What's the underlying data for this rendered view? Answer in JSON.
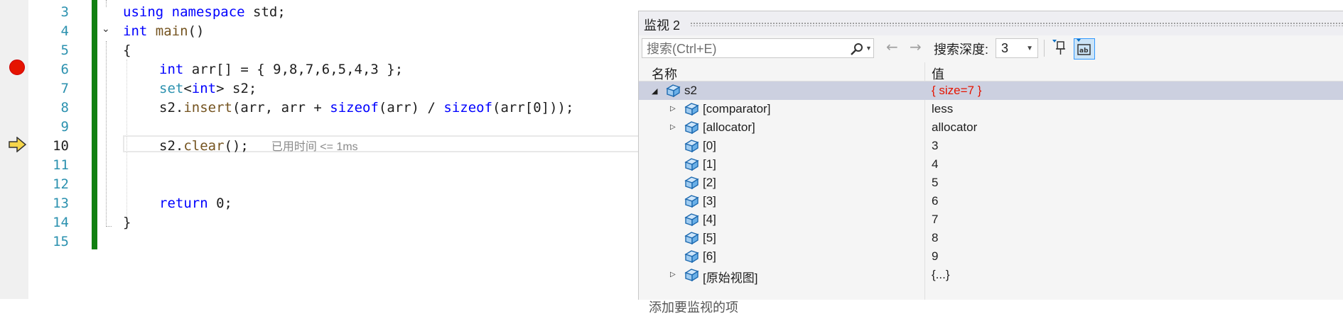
{
  "editor": {
    "line_numbers": [
      "3",
      "4",
      "5",
      "6",
      "7",
      "8",
      "9",
      "10",
      "11",
      "12",
      "13",
      "14",
      "15"
    ],
    "current_line": "10",
    "code": {
      "l3": {
        "kw1": "using",
        "kw2": "namespace",
        "rest": " std;"
      },
      "l4": {
        "kw": "int",
        "fn": "main",
        "rest": "()"
      },
      "l5": "{",
      "l6": {
        "kw": "int",
        "rest": " arr[] = { 9,8,7,6,5,4,3 };"
      },
      "l7": {
        "ty1": "set",
        "lt": "<",
        "ty2": "int",
        "gt": ">",
        "rest": " s2;"
      },
      "l8": {
        "a": "s2.",
        "fn": "insert",
        "b": "(arr, arr + ",
        "kw1": "sizeof",
        "c": "(arr) / ",
        "kw2": "sizeof",
        "d": "(arr[0]));"
      },
      "l10": {
        "a": "s2.",
        "fn": "clear",
        "b": "();"
      },
      "l13": {
        "kw": "return",
        "rest": " 0;"
      },
      "l14": "}"
    },
    "perf_tip": "已用时间 <= 1ms"
  },
  "watch": {
    "title": "监视 2",
    "search_placeholder": "搜索(Ctrl+E)",
    "depth_label": "搜索深度:",
    "depth_value": "3",
    "columns": {
      "name": "名称",
      "value": "值"
    },
    "rows": [
      {
        "name": "s2",
        "value": "{ size=7 }"
      },
      {
        "name": "[comparator]",
        "value": "less"
      },
      {
        "name": "[allocator]",
        "value": "allocator"
      },
      {
        "name": "[0]",
        "value": "3"
      },
      {
        "name": "[1]",
        "value": "4"
      },
      {
        "name": "[2]",
        "value": "5"
      },
      {
        "name": "[3]",
        "value": "6"
      },
      {
        "name": "[4]",
        "value": "7"
      },
      {
        "name": "[5]",
        "value": "8"
      },
      {
        "name": "[6]",
        "value": "9"
      },
      {
        "name": "[原始视图]",
        "value": "{...}"
      }
    ],
    "add_item": "添加要监视的项"
  },
  "colors": {
    "accent": "#0000ff",
    "changed_value": "#e51400",
    "change_bar": "#108010",
    "selected_row": "#ccd0e0"
  }
}
